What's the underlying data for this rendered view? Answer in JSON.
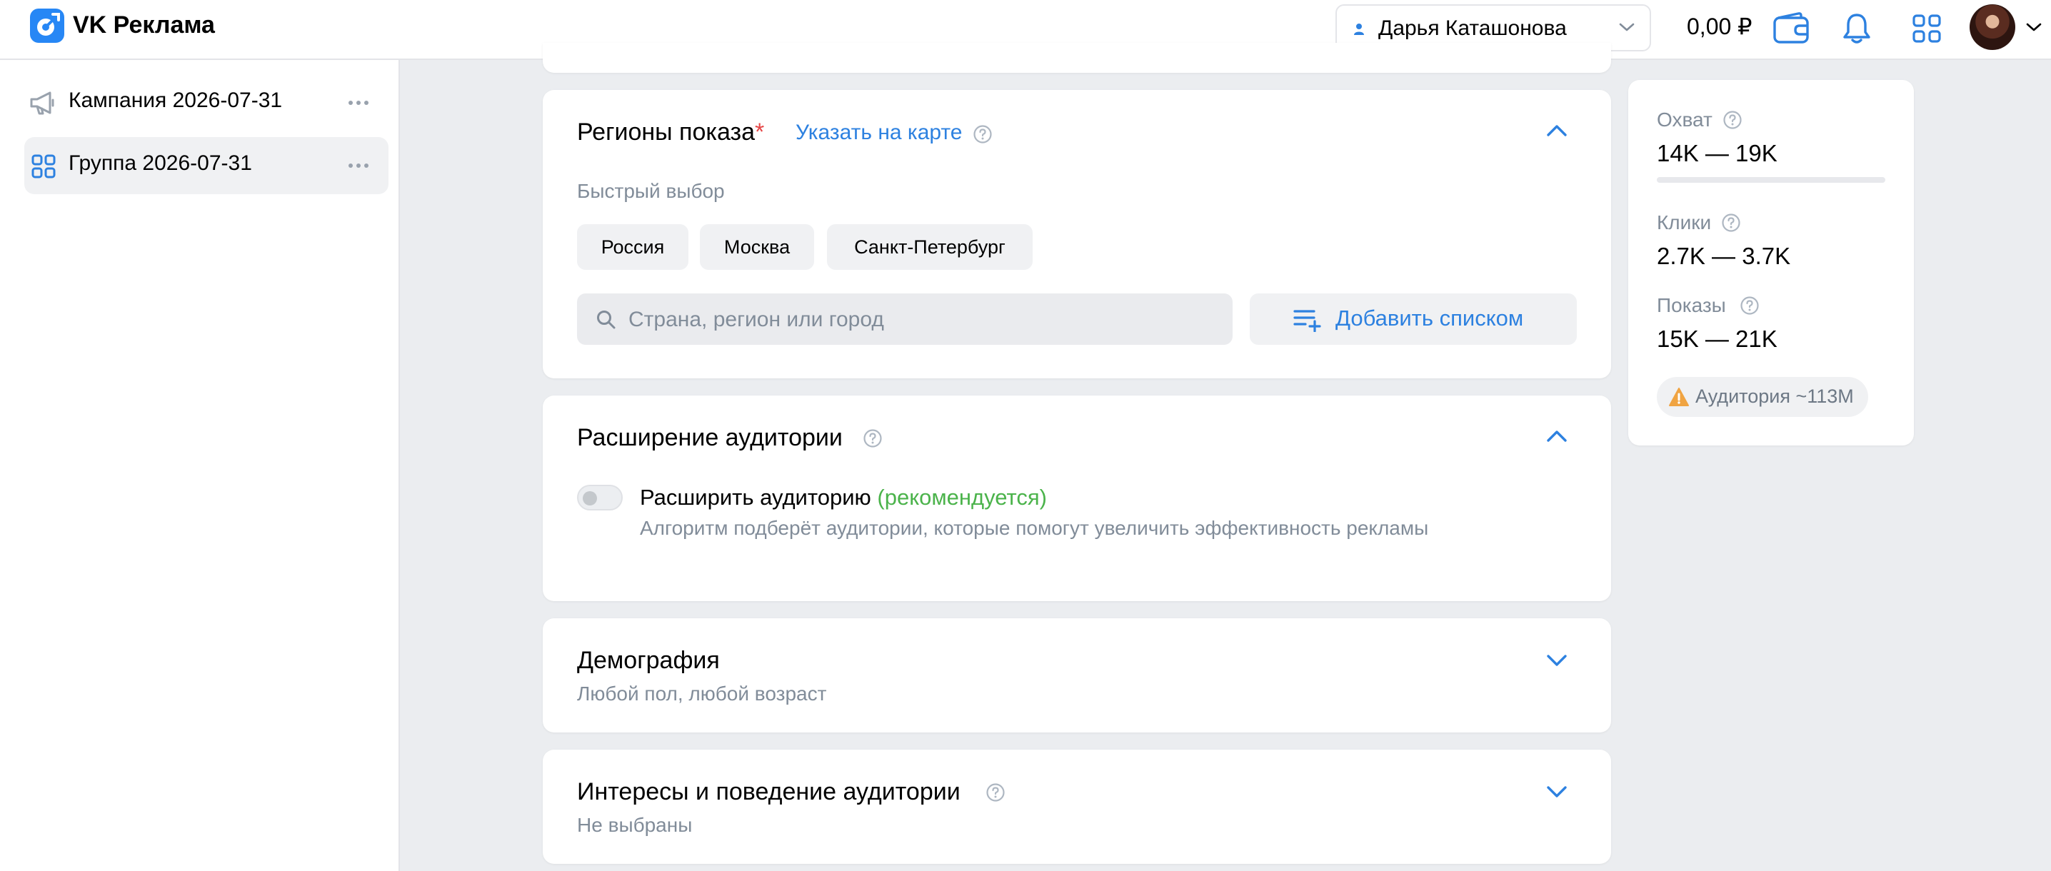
{
  "header": {
    "app_title": "VK Реклама",
    "account_name": "Дарья Каташонова",
    "balance": "0,00 ₽",
    "icons": [
      "wallet-icon",
      "bell-icon",
      "apps-grid-icon",
      "avatar",
      "chevron-down-icon"
    ]
  },
  "sidebar": {
    "items": [
      {
        "label": "Кампания 2026-07-31",
        "icon": "megaphone-icon"
      },
      {
        "label": "Группа 2026-07-31",
        "icon": "grid-icon",
        "active": true
      }
    ]
  },
  "regions": {
    "title": "Регионы показа",
    "required_mark": "*",
    "map_link": "Указать на карте",
    "quick_label": "Быстрый выбор",
    "chips": [
      "Россия",
      "Москва",
      "Санкт-Петербург"
    ],
    "search_placeholder": "Страна, регион или город",
    "add_list_label": "Добавить списком"
  },
  "expansion": {
    "title": "Расширение аудитории",
    "toggle_label": "Расширить аудиторию",
    "toggle_recommend": "(рекомендуется)",
    "toggle_on": false,
    "description": "Алгоритм подберёт аудитории, которые помогут увеличить эффективность рекламы"
  },
  "demography": {
    "title": "Демография",
    "subtitle": "Любой пол, любой возраст"
  },
  "interests": {
    "title": "Интересы и поведение аудитории",
    "subtitle": "Не выбраны"
  },
  "forecast": {
    "reach_label": "Охват",
    "reach_value": "14K — 19K",
    "clicks_label": "Клики",
    "clicks_value": "2.7K — 3.7K",
    "impressions_label": "Показы",
    "impressions_value": "15K — 21K",
    "audience_badge": "Аудитория ~113M"
  },
  "colors": {
    "accent": "#2d81e0",
    "required": "#e64646",
    "recommend": "#4bb34b",
    "warning": "#f0a442",
    "background": "#ebedf0"
  }
}
